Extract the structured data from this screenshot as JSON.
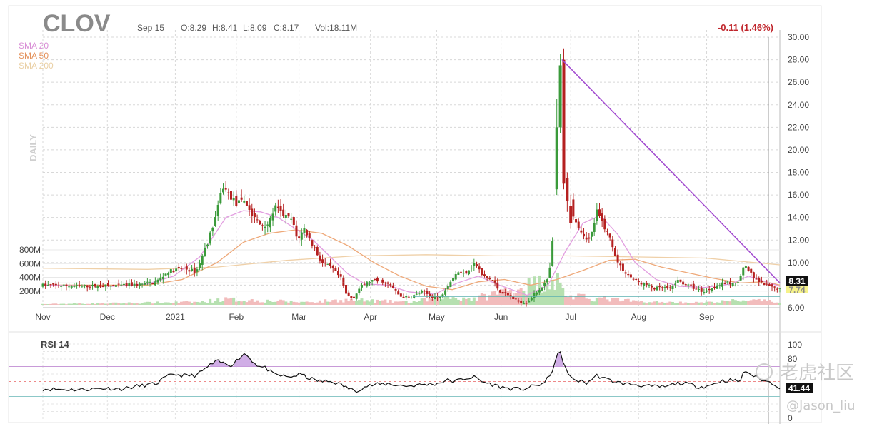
{
  "header": {
    "ticker": "CLOV",
    "date": "Sep 15",
    "open": "O:8.29",
    "high": "H:8.41",
    "low": "L:8.09",
    "close": "C:8.17",
    "volume": "Vol:18.11M",
    "change": "-0.11 (1.46%)"
  },
  "legend": {
    "sma20": "SMA 20",
    "sma50": "SMA 50",
    "sma200": "SMA 200",
    "daily": "DAILY"
  },
  "badges": {
    "last_price": "8.31",
    "trendline_price": "7.74",
    "rsi_value": "41.44"
  },
  "rsi": {
    "title": "RSI 14",
    "tick_labels": [
      "100",
      "80",
      "0"
    ]
  },
  "watermark": {
    "line1": "老虎社区",
    "line2": "@Jason_liu"
  },
  "colors": {
    "up": "#3a9a3a",
    "down": "#b52020",
    "sma20": "#e29de0",
    "sma50": "#eea878",
    "sma200": "#efd0a8",
    "trendline": "#a24ad0",
    "volume_up": "#b6e0b0",
    "volume_down": "#f2bcbc",
    "rsi_line": "#111111",
    "rsi_fill": "#c49ae0",
    "change_text": "#c0262c"
  },
  "chart_data": [
    {
      "type": "candlestick",
      "title": "CLOV",
      "x_labels": [
        "Nov",
        "Dec",
        "2021",
        "Feb",
        "Mar",
        "Apr",
        "May",
        "Jun",
        "Jul",
        "Aug",
        "Sep"
      ],
      "y_ticks": [
        "30.00",
        "28.00",
        "26.00",
        "24.00",
        "22.00",
        "20.00",
        "18.00",
        "16.00",
        "14.00",
        "12.00",
        "10.00",
        "8.00",
        "6.00"
      ],
      "ylim": [
        6,
        30
      ],
      "volume_ticks": [
        "800M",
        "600M",
        "400M",
        "200M"
      ],
      "volume_max": 1000,
      "grid": true,
      "legend_position": "top-left",
      "price_path": [
        [
          0,
          8.0
        ],
        [
          20,
          7.9
        ],
        [
          40,
          7.95
        ],
        [
          55,
          8.05
        ],
        [
          65,
          8.3
        ],
        [
          72,
          9.2
        ],
        [
          80,
          9.5
        ],
        [
          88,
          9.2
        ],
        [
          95,
          12.0
        ],
        [
          100,
          14.5
        ],
        [
          103,
          16.8
        ],
        [
          107,
          16.0
        ],
        [
          111,
          15.2
        ],
        [
          116,
          15.5
        ],
        [
          120,
          14.2
        ],
        [
          125,
          13.3
        ],
        [
          130,
          13.5
        ],
        [
          133,
          15.0
        ],
        [
          136,
          14.5
        ],
        [
          140,
          14.0
        ],
        [
          143,
          13.8
        ],
        [
          146,
          12.0
        ],
        [
          150,
          13.0
        ],
        [
          155,
          11.5
        ],
        [
          160,
          10.0
        ],
        [
          166,
          9.5
        ],
        [
          171,
          8.6
        ],
        [
          174,
          7.2
        ],
        [
          178,
          6.8
        ],
        [
          182,
          7.8
        ],
        [
          188,
          8.4
        ],
        [
          195,
          8.3
        ],
        [
          200,
          7.9
        ],
        [
          205,
          7.0
        ],
        [
          210,
          6.9
        ],
        [
          218,
          7.4
        ],
        [
          223,
          7.0
        ],
        [
          228,
          6.9
        ],
        [
          233,
          8.2
        ],
        [
          238,
          9.2
        ],
        [
          242,
          9.0
        ],
        [
          248,
          10.0
        ],
        [
          252,
          8.9
        ],
        [
          258,
          8.4
        ],
        [
          262,
          7.5
        ],
        [
          268,
          7.0
        ],
        [
          272,
          6.6
        ],
        [
          277,
          6.4
        ],
        [
          281,
          7.0
        ],
        [
          286,
          7.8
        ],
        [
          290,
          8.5
        ],
        [
          292,
          10.5
        ],
        [
          295,
          18.0
        ],
        [
          297,
          24.0
        ],
        [
          298,
          28.0
        ],
        [
          300,
          22.0
        ],
        [
          302,
          16.0
        ],
        [
          305,
          14.0
        ],
        [
          310,
          12.5
        ],
        [
          314,
          12.0
        ],
        [
          318,
          14.5
        ],
        [
          322,
          13.3
        ],
        [
          326,
          12.0
        ],
        [
          330,
          10.0
        ],
        [
          335,
          9.0
        ],
        [
          341,
          8.3
        ],
        [
          347,
          8.0
        ],
        [
          351,
          7.7
        ],
        [
          356,
          7.8
        ],
        [
          360,
          7.6
        ],
        [
          364,
          8.4
        ],
        [
          370,
          8.0
        ],
        [
          376,
          7.6
        ],
        [
          380,
          7.4
        ],
        [
          385,
          7.9
        ],
        [
          392,
          8.2
        ],
        [
          398,
          8.1
        ],
        [
          403,
          9.8
        ],
        [
          408,
          8.6
        ],
        [
          413,
          8.1
        ],
        [
          418,
          7.8
        ],
        [
          423,
          7.7
        ]
      ],
      "sma20_path": [
        [
          0,
          8.0
        ],
        [
          40,
          7.9
        ],
        [
          60,
          8.1
        ],
        [
          75,
          8.8
        ],
        [
          90,
          10.5
        ],
        [
          105,
          14.0
        ],
        [
          115,
          14.6
        ],
        [
          125,
          14.5
        ],
        [
          135,
          14.0
        ],
        [
          145,
          13.0
        ],
        [
          155,
          12.0
        ],
        [
          165,
          10.5
        ],
        [
          175,
          9.0
        ],
        [
          185,
          8.1
        ],
        [
          198,
          8.0
        ],
        [
          210,
          7.4
        ],
        [
          225,
          7.2
        ],
        [
          238,
          8.2
        ],
        [
          250,
          8.8
        ],
        [
          262,
          8.0
        ],
        [
          278,
          7.1
        ],
        [
          290,
          8.0
        ],
        [
          300,
          11.0
        ],
        [
          310,
          13.5
        ],
        [
          320,
          14.2
        ],
        [
          330,
          12.5
        ],
        [
          340,
          10.0
        ],
        [
          352,
          8.5
        ],
        [
          365,
          7.9
        ],
        [
          380,
          7.8
        ],
        [
          395,
          8.1
        ],
        [
          405,
          8.8
        ],
        [
          415,
          8.3
        ],
        [
          423,
          7.9
        ]
      ],
      "sma50_path": [
        [
          0,
          8.0
        ],
        [
          60,
          8.0
        ],
        [
          80,
          8.5
        ],
        [
          100,
          10.0
        ],
        [
          115,
          11.8
        ],
        [
          130,
          12.6
        ],
        [
          145,
          12.9
        ],
        [
          160,
          12.6
        ],
        [
          175,
          11.5
        ],
        [
          190,
          10.0
        ],
        [
          205,
          8.8
        ],
        [
          220,
          7.9
        ],
        [
          235,
          7.6
        ],
        [
          250,
          8.3
        ],
        [
          265,
          8.5
        ],
        [
          280,
          8.0
        ],
        [
          295,
          8.5
        ],
        [
          310,
          9.3
        ],
        [
          325,
          10.2
        ],
        [
          340,
          10.3
        ],
        [
          355,
          9.6
        ],
        [
          370,
          9.1
        ],
        [
          385,
          8.6
        ],
        [
          400,
          8.2
        ],
        [
          415,
          8.3
        ],
        [
          423,
          8.0
        ]
      ],
      "sma200_path": [
        [
          0,
          9.5
        ],
        [
          60,
          9.4
        ],
        [
          100,
          9.6
        ],
        [
          140,
          10.2
        ],
        [
          180,
          10.6
        ],
        [
          220,
          10.7
        ],
        [
          260,
          10.6
        ],
        [
          300,
          10.6
        ],
        [
          340,
          10.5
        ],
        [
          380,
          10.4
        ],
        [
          423,
          9.8
        ]
      ],
      "trendline": [
        [
          298,
          28.0
        ],
        [
          423,
          8.2
        ]
      ],
      "horizontal_line": 7.74,
      "big_spike_candles": [
        {
          "t": 295,
          "o": 16.5,
          "c": 22.0,
          "h": 24.5,
          "l": 16.0
        },
        {
          "t": 297,
          "o": 22.0,
          "c": 27.5,
          "h": 28.5,
          "l": 21.5
        },
        {
          "t": 299,
          "o": 28.0,
          "c": 17.0,
          "h": 29.0,
          "l": 16.5
        },
        {
          "t": 301,
          "o": 17.5,
          "c": 15.5,
          "h": 18.0,
          "l": 14.5
        },
        {
          "t": 303,
          "o": 15.0,
          "c": 13.5,
          "h": 16.0,
          "l": 13.0
        }
      ],
      "volume_path": [
        [
          0,
          10
        ],
        [
          90,
          40
        ],
        [
          103,
          80
        ],
        [
          150,
          40
        ],
        [
          174,
          70
        ],
        [
          210,
          40
        ],
        [
          233,
          110
        ],
        [
          248,
          90
        ],
        [
          295,
          380
        ],
        [
          298,
          220
        ],
        [
          302,
          120
        ],
        [
          320,
          90
        ],
        [
          345,
          40
        ],
        [
          380,
          30
        ],
        [
          403,
          70
        ],
        [
          423,
          40
        ]
      ]
    },
    {
      "type": "line",
      "title": "RSI 14",
      "y_ticks": [
        "100",
        "80",
        "0"
      ],
      "ylim": [
        0,
        100
      ],
      "overbought": 70,
      "oversold": 30,
      "midline": 50,
      "values_path": [
        [
          0,
          40
        ],
        [
          20,
          39
        ],
        [
          35,
          41
        ],
        [
          45,
          40
        ],
        [
          55,
          44
        ],
        [
          65,
          47
        ],
        [
          70,
          55
        ],
        [
          75,
          60
        ],
        [
          80,
          58
        ],
        [
          88,
          58
        ],
        [
          92,
          65
        ],
        [
          96,
          72
        ],
        [
          100,
          77
        ],
        [
          104,
          74
        ],
        [
          108,
          72
        ],
        [
          112,
          80
        ],
        [
          116,
          88
        ],
        [
          120,
          78
        ],
        [
          124,
          70
        ],
        [
          128,
          68
        ],
        [
          132,
          60
        ],
        [
          136,
          58
        ],
        [
          140,
          56
        ],
        [
          144,
          57
        ],
        [
          148,
          60
        ],
        [
          152,
          55
        ],
        [
          156,
          52
        ],
        [
          160,
          50
        ],
        [
          166,
          50
        ],
        [
          172,
          45
        ],
        [
          176,
          40
        ],
        [
          180,
          38
        ],
        [
          186,
          44
        ],
        [
          192,
          46
        ],
        [
          198,
          47
        ],
        [
          204,
          45
        ],
        [
          210,
          44
        ],
        [
          218,
          46
        ],
        [
          226,
          47
        ],
        [
          232,
          52
        ],
        [
          236,
          50
        ],
        [
          242,
          54
        ],
        [
          248,
          56
        ],
        [
          252,
          50
        ],
        [
          258,
          46
        ],
        [
          264,
          42
        ],
        [
          270,
          40
        ],
        [
          276,
          40
        ],
        [
          282,
          44
        ],
        [
          288,
          48
        ],
        [
          292,
          62
        ],
        [
          295,
          84
        ],
        [
          297,
          88
        ],
        [
          299,
          75
        ],
        [
          302,
          56
        ],
        [
          306,
          52
        ],
        [
          312,
          48
        ],
        [
          318,
          58
        ],
        [
          322,
          54
        ],
        [
          328,
          50
        ],
        [
          334,
          47
        ],
        [
          340,
          46
        ],
        [
          346,
          44
        ],
        [
          352,
          43
        ],
        [
          358,
          43
        ],
        [
          364,
          48
        ],
        [
          370,
          47
        ],
        [
          376,
          43
        ],
        [
          382,
          44
        ],
        [
          388,
          50
        ],
        [
          394,
          52
        ],
        [
          400,
          50
        ],
        [
          403,
          65
        ],
        [
          406,
          60
        ],
        [
          410,
          55
        ],
        [
          415,
          50
        ],
        [
          419,
          48
        ],
        [
          423,
          42
        ]
      ],
      "last_value": 41.44
    }
  ]
}
